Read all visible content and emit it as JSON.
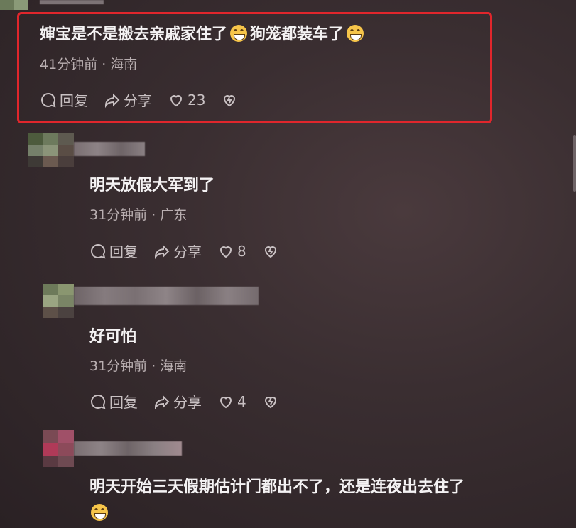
{
  "comments": [
    {
      "text_a": "婶宝是不是搬去亲戚家住了",
      "emoji_a": "rofl-emoji",
      "text_b": "狗笼都装车了",
      "emoji_b": "grin-emoji",
      "time": "41分钟前 · 海南",
      "reply": "回复",
      "share": "分享",
      "likes": "23"
    },
    {
      "text": "明天放假大军到了",
      "time": "31分钟前 · 广东",
      "reply": "回复",
      "share": "分享",
      "likes": "8"
    },
    {
      "text": "好可怕",
      "time": "31分钟前 · 海南",
      "reply": "回复",
      "share": "分享",
      "likes": "4"
    },
    {
      "text": "明天开始三天假期估计门都出不了，还是连夜出去住了",
      "emoji": "rofl-emoji"
    }
  ],
  "colors": {
    "highlight": "#e0262c",
    "text": "#f4f2f3",
    "meta": "#b9afb1"
  }
}
